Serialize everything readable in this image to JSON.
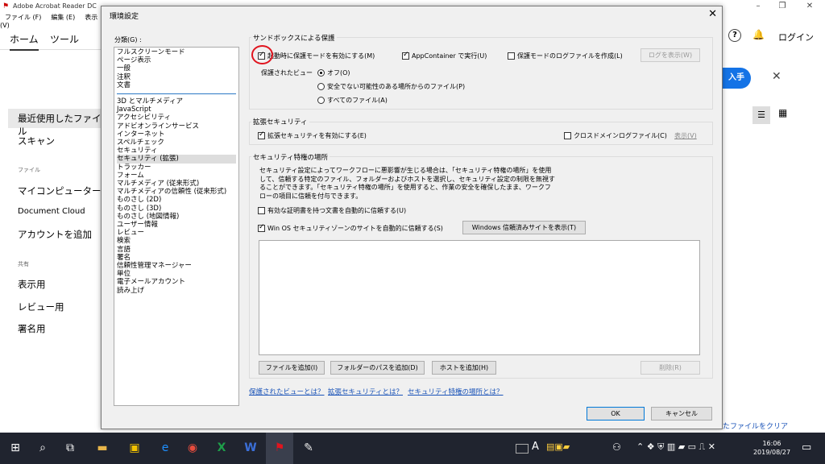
{
  "app": {
    "title": "Adobe Acrobat Reader DC",
    "menu": [
      "ファイル (F)",
      "編集 (E)",
      "表示(V)"
    ],
    "tabs": [
      "ホーム",
      "ツール"
    ],
    "login": "ログイン",
    "sidebar": {
      "recent": "最近使用したファイル",
      "scan": "スキャン",
      "files_header": "ファイル",
      "my_computer": "マイコンピューター",
      "document_cloud": "Document Cloud",
      "add_account": "アカウントを追加",
      "shared_header": "共有",
      "display": "表示用",
      "review": "レビュー用",
      "sign": "署名用"
    },
    "right": {
      "banner_btn": "入手",
      "clear_recent": "最近使用したファイルをクリア"
    }
  },
  "dialog": {
    "title": "環境設定",
    "category_label": "分類(G) :",
    "categories_top": [
      "フルスクリーンモード",
      "ページ表示",
      "一般",
      "注釈",
      "文書"
    ],
    "categories": [
      "3D とマルチメディア",
      "JavaScript",
      "アクセシビリティ",
      "アドビオンラインサービス",
      "インターネット",
      "スペルチェック",
      "セキュリティ",
      "セキュリティ (拡張)",
      "トラッカー",
      "フォーム",
      "マルチメディア (従来形式)",
      "マルチメディアの信頼性 (従来形式)",
      "ものさし (2D)",
      "ものさし (3D)",
      "ものさし (地図情報)",
      "ユーザー情報",
      "レビュー",
      "検索",
      "言語",
      "署名",
      "信頼性管理マネージャー",
      "単位",
      "電子メールアカウント",
      "読み上げ"
    ],
    "selected_index": 7,
    "sandbox": {
      "title": "サンドボックスによる保護",
      "protected_mode": "起動時に保護モードを有効にする(M)",
      "appcontainer": "AppContainer で実行(U)",
      "logfile": "保護モードのログファイルを作成(L)",
      "show_log": "ログを表示(W)",
      "protected_view_label": "保護されたビュー",
      "pv_off": "オフ(O)",
      "pv_unsafe": "安全でない可能性のある場所からのファイル(P)",
      "pv_all": "すべてのファイル(A)"
    },
    "enhanced": {
      "title": "拡張セキュリティ",
      "enable": "拡張セキュリティを有効にする(E)",
      "crossdomain": "クロスドメインログファイル(C)",
      "show": "表示(V)"
    },
    "privileged": {
      "title": "セキュリティ特権の場所",
      "desc1": "セキュリティ設定によってワークフローに悪影響が生じる場合は、「セキュリティ特権の場所」を使用",
      "desc2": "して、信頼する特定のファイル、フォルダーおよびホストを選択し、セキュリティ設定の制限を無視す",
      "desc3": "ることができます。「セキュリティ特権の場所」を使用すると、作業の安全を確保したまま、ワークフ",
      "desc4": "ローの項目に信頼を付与できます。",
      "cert": "有効な証明書を持つ文書を自動的に信頼する(U)",
      "winos": "Win OS セキュリティゾーンのサイトを自動的に信頼する(S)",
      "show_sites": "Windows 信頼済みサイトを表示(T)",
      "add_file": "ファイルを追加(I)",
      "add_folder": "フォルダーのパスを追加(D)",
      "add_host": "ホストを追加(H)",
      "delete": "削除(R)"
    },
    "links": [
      "保護されたビューとは？",
      "拡張セキュリティとは？",
      "セキュリティ特権の場所とは？"
    ],
    "ok": "OK",
    "cancel": "キャンセル"
  },
  "taskbar": {
    "time": "16:06",
    "date": "2019/08/27",
    "ime": "A"
  }
}
